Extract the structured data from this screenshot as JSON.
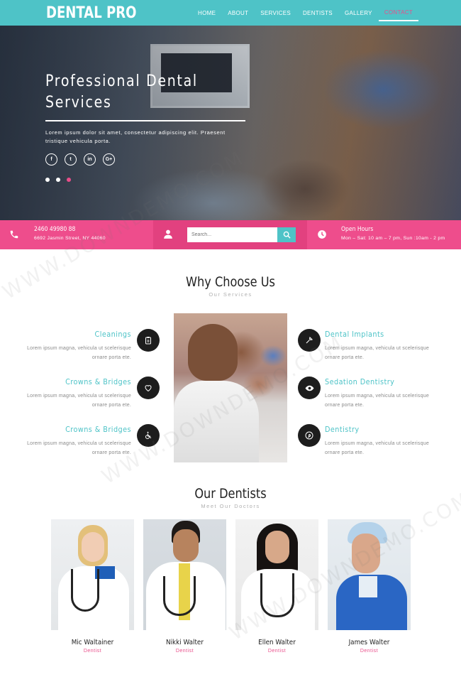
{
  "brand": {
    "logo": "DENTAL PRO"
  },
  "nav": {
    "items": [
      {
        "label": "HOME"
      },
      {
        "label": "ABOUT"
      },
      {
        "label": "SERVICES"
      },
      {
        "label": "DENTISTS"
      },
      {
        "label": "GALLERY"
      },
      {
        "label": "CONTACT"
      }
    ],
    "active": "CONTACT"
  },
  "hero": {
    "title": "Professional Dental Services",
    "text": "Lorem ipsum dolor sit amet, consectetur adipiscing elit. Praesent tristique vehicula porta.",
    "socials": [
      {
        "icon": "facebook-icon",
        "glyph": "f"
      },
      {
        "icon": "twitter-icon",
        "glyph": "t"
      },
      {
        "icon": "linkedin-icon",
        "glyph": "in"
      },
      {
        "icon": "google-plus-icon",
        "glyph": "G+"
      }
    ],
    "slides": 3,
    "active_slide": 3
  },
  "infobar": {
    "phone": "2460 49980 88",
    "address": "6692 Jasmin Street, NY 44060",
    "search_placeholder": "Search...",
    "hours_title": "Open Hours",
    "hours_text": "Mon – Sat: 10 am – 7 pm, Sun :10am - 2 pm"
  },
  "why": {
    "title": "Why Choose Us",
    "subtitle": "Our Services",
    "services_left": [
      {
        "title": "Cleanings",
        "text": "Lorem ipsum magna, vehicula ut scelerisque ornare porta ete.",
        "icon": "clipboard-icon"
      },
      {
        "title": "Crowns & Bridges",
        "text": "Lorem ipsum magna, vehicula ut scelerisque ornare porta ete.",
        "icon": "heart-icon"
      },
      {
        "title": "Crowns & Bridges",
        "text": "Lorem ipsum magna, vehicula ut scelerisque ornare porta ete.",
        "icon": "wheelchair-icon"
      }
    ],
    "services_right": [
      {
        "title": "Dental Implants",
        "text": "Lorem ipsum magna, vehicula ut scelerisque ornare porta ete.",
        "icon": "eyedropper-icon"
      },
      {
        "title": "Sedation Dentistry",
        "text": "Lorem ipsum magna, vehicula ut scelerisque ornare porta ete.",
        "icon": "eye-icon"
      },
      {
        "title": "Dentistry",
        "text": "Lorem ipsum magna, vehicula ut scelerisque ornare porta ete.",
        "icon": "pinterest-icon"
      }
    ]
  },
  "dentists": {
    "title": "Our Dentists",
    "subtitle": "Meet Our Doctors",
    "people": [
      {
        "name": "Mic Waltainer",
        "role": "Dentist"
      },
      {
        "name": "Nikki Walter",
        "role": "Dentist"
      },
      {
        "name": "Ellen Walter",
        "role": "Dentist"
      },
      {
        "name": "James Walter",
        "role": "Dentist"
      }
    ]
  },
  "watermark": "WWW.DOWNDEMO.COM",
  "colors": {
    "teal": "#4ec3c7",
    "pink": "#ee4d8c",
    "dark": "#1d1d1d"
  }
}
